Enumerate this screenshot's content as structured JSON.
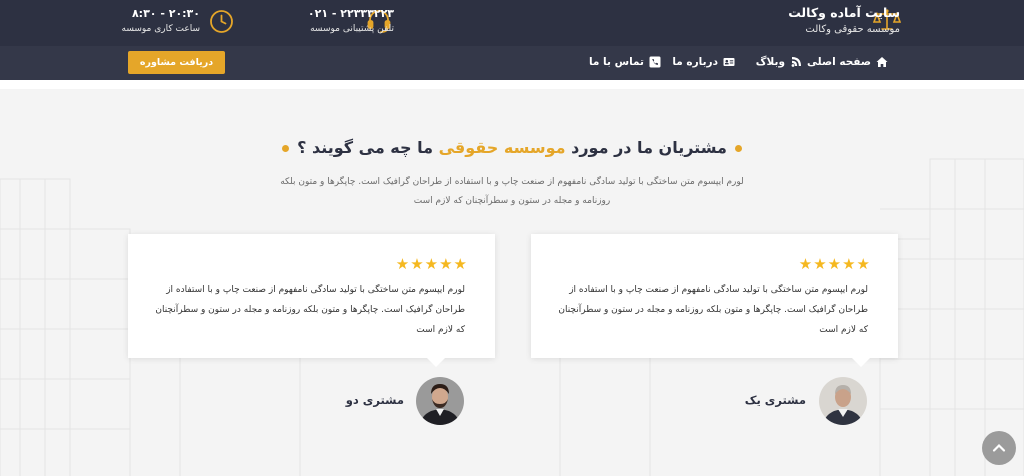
{
  "header": {
    "brand_title": "سایت آماده وکالت",
    "brand_subtitle": "موسسه حقوقی وکالت",
    "phone_value": "۰۲۱ - ۲۲۳۳۳۲۲۳",
    "phone_label": "تلفن پشتیبانی موسسه",
    "hours_value": "۸:۳۰ - ۲۰:۳۰",
    "hours_label": "ساعت کاری موسسه"
  },
  "nav": {
    "items": [
      {
        "label": "صفحه اصلی",
        "icon": "home-icon"
      },
      {
        "label": "وبلاگ",
        "icon": "blog-icon"
      },
      {
        "label": "درباره ما",
        "icon": "id-card-icon"
      },
      {
        "label": "تماس با ما",
        "icon": "phone-square-icon"
      }
    ],
    "cta_label": "دریافت مشاوره"
  },
  "section": {
    "title_before": "مشتریان ما در مورد ",
    "title_highlight": "موسسه حقوقی",
    "title_after": " ما چه می گویند ؟",
    "intro": "لورم ایپسوم متن ساختگی با تولید سادگی نامفهوم از صنعت چاپ و با استفاده از طراحان گرافیک است. چاپگرها و متون بلکه روزنامه و مجله در ستون و سطرآنچنان که لازم است"
  },
  "testimonials": [
    {
      "rating": 5,
      "text": "لورم ایپسوم متن ساختگی با تولید سادگی نامفهوم از صنعت چاپ و با استفاده از طراحان گرافیک است. چاپگرها و متون بلکه روزنامه و مجله در ستون و سطرآنچنان که لازم است",
      "name": "مشتری یک"
    },
    {
      "rating": 5,
      "text": "لورم ایپسوم متن ساختگی با تولید سادگی نامفهوم از صنعت چاپ و با استفاده از طراحان گرافیک است. چاپگرها و متون بلکه روزنامه و مجله در ستون و سطرآنچنان که لازم است",
      "name": "مشتری دو"
    }
  ],
  "colors": {
    "header_bg": "#2d3142",
    "nav_bg": "#343849",
    "accent": "#e5a629",
    "star": "#f5b820"
  }
}
